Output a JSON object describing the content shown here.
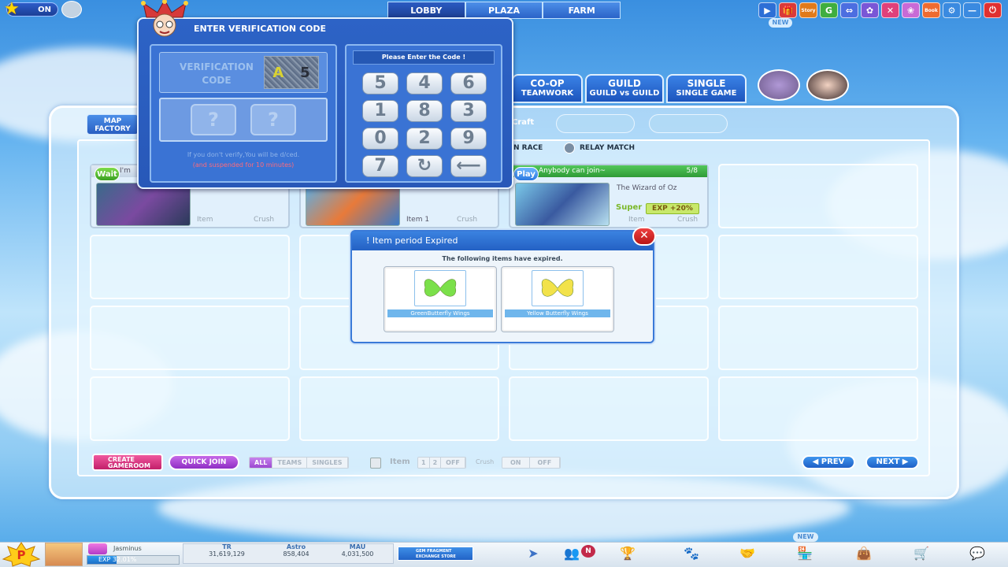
{
  "top": {
    "on_label": "ON",
    "nav_tabs": [
      "LOBBY",
      "PLAZA",
      "FARM"
    ],
    "icons": [
      {
        "name": "play-icon",
        "glyph": "▶",
        "color": "#2d6fd6"
      },
      {
        "name": "gift-icon",
        "glyph": "🎁",
        "color": "#d93a3a"
      },
      {
        "name": "store-icon",
        "glyph": "Story",
        "color": "#e07a1a"
      },
      {
        "name": "g-icon",
        "glyph": "G",
        "color": "#3fae3f"
      },
      {
        "name": "link-icon",
        "glyph": "⇔",
        "color": "#4c6ee0"
      },
      {
        "name": "gear-purple-icon",
        "glyph": "✿",
        "color": "#7a56d6"
      },
      {
        "name": "x-icon",
        "glyph": "✕",
        "color": "#e0407a"
      },
      {
        "name": "flower-icon",
        "glyph": "❀",
        "color": "#c86ad6"
      },
      {
        "name": "book-icon",
        "glyph": "Book",
        "color": "#ee6b30"
      },
      {
        "name": "settings-icon",
        "glyph": "⚙",
        "color": "#3a8ae0"
      },
      {
        "name": "minimize-icon",
        "glyph": "—",
        "color": "#3a8ae0"
      },
      {
        "name": "power-icon",
        "glyph": "⏻",
        "color": "#e03030"
      }
    ],
    "new_tag": "NEW"
  },
  "modes": [
    {
      "title": "CO-OP",
      "sub": "TEAMWORK"
    },
    {
      "title": "GUILD",
      "sub": "GUILD vs GUILD"
    },
    {
      "title": "SINGLE",
      "sub": "SINGLE GAME"
    }
  ],
  "toolbar": {
    "map_factory": "MAP FACTORY",
    "craft": "Craft",
    "race": "N RACE",
    "relay": "RELAY MATCH"
  },
  "rooms": [
    {
      "badge": "Wait",
      "title": "I'm",
      "item": "Item",
      "crush": "Crush"
    },
    {
      "badge": "",
      "title": "",
      "item": "Item 1",
      "crush": "Crush"
    },
    {
      "badge": "Play",
      "head": "Anybody can join~",
      "count": "5/8",
      "title": "The Wizard of Oz",
      "super": "Super",
      "exp": "EXP +20%",
      "item": "Item",
      "crush": "Crush"
    }
  ],
  "controls": {
    "create": "CREATE GAMEROOM",
    "quick_join": "QUICK JOIN",
    "filters": [
      "ALL",
      "TEAMS",
      "SINGLES"
    ],
    "item_label": "Item",
    "item_opts": [
      "1",
      "2",
      "OFF"
    ],
    "crush_label": "Crush",
    "crush_opts": [
      "ON",
      "OFF"
    ],
    "prev": "PREV",
    "next": "NEXT"
  },
  "verify": {
    "title": "ENTER VERIFICATION CODE",
    "code_label": "VERIFICATION CODE",
    "captcha": [
      "A",
      "5"
    ],
    "placeholder": [
      "?",
      "?"
    ],
    "warn1": "If you don't verify,You will be d/ced.",
    "warn2": "(and suspended for 10 minutes)",
    "prompt": "Please Enter the Code !",
    "keys": [
      "5",
      "4",
      "6",
      "1",
      "8",
      "3",
      "0",
      "2",
      "9",
      "7",
      "↻",
      "⟵"
    ]
  },
  "expired": {
    "title": "! Item period Expired",
    "message": "The following items have expired.",
    "items": [
      {
        "name": "GreenButterfly Wings",
        "color": "#7be04a"
      },
      {
        "name": "Yellow Butterfly Wings",
        "color": "#f2e24a"
      }
    ]
  },
  "status": {
    "username": "Jasminus",
    "exp_text": "EXP 32.01%",
    "exp_fraction": 0.3201,
    "stats": [
      {
        "label": "TR",
        "value": "31,619,129"
      },
      {
        "label": "Astro",
        "value": "858,404"
      },
      {
        "label": "MAU",
        "value": "4,031,500"
      }
    ],
    "gem_store": "GEM FRAGMENT EXCHANGE STORE",
    "new_tag": "NEW"
  }
}
